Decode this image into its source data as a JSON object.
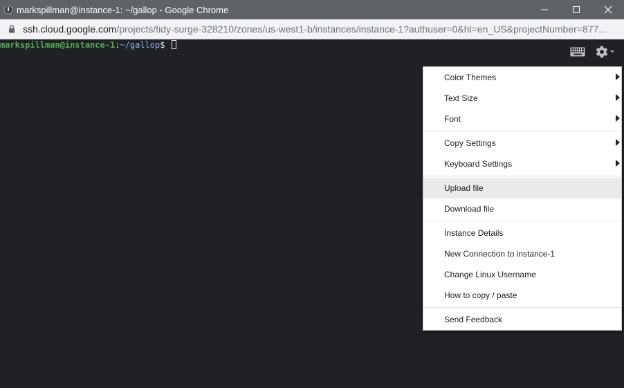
{
  "window": {
    "title": "markspillman@instance-1: ~/gallop - Google Chrome"
  },
  "addressbar": {
    "url_host": "ssh.cloud.google.com",
    "url_path": "/projects/tidy-surge-328210/zones/us-west1-b/instances/instance-1?authuser=0&hl=en_US&projectNumber=877..."
  },
  "terminal": {
    "prompt_user": "markspillman@instance-1",
    "prompt_colon": ":",
    "prompt_path": "~/gallop",
    "prompt_symbol": "$"
  },
  "menu": {
    "group1": [
      {
        "label": "Color Themes",
        "submenu": true
      },
      {
        "label": "Text Size",
        "submenu": true
      },
      {
        "label": "Font",
        "submenu": true
      }
    ],
    "group2": [
      {
        "label": "Copy Settings",
        "submenu": true
      },
      {
        "label": "Keyboard Settings",
        "submenu": true
      }
    ],
    "group3": [
      {
        "label": "Upload file",
        "highlighted": true
      },
      {
        "label": "Download file"
      }
    ],
    "group4": [
      {
        "label": "Instance Details"
      },
      {
        "label": "New Connection to instance-1"
      },
      {
        "label": "Change Linux Username"
      },
      {
        "label": "How to copy / paste"
      }
    ],
    "group5": [
      {
        "label": "Send Feedback"
      }
    ]
  },
  "icons": {
    "app": "chrome-app-icon",
    "minimize": "minimize-icon",
    "maximize": "maximize-icon",
    "close": "close-icon",
    "lock": "lock-icon",
    "keyboard": "keyboard-icon",
    "settings": "gear-icon"
  },
  "colors": {
    "titlebar": "#5f6368",
    "terminal_bg": "#202124",
    "prompt_user": "#4caf50",
    "prompt_path": "#8ab4f8",
    "menu_highlight": "#ebebeb"
  }
}
